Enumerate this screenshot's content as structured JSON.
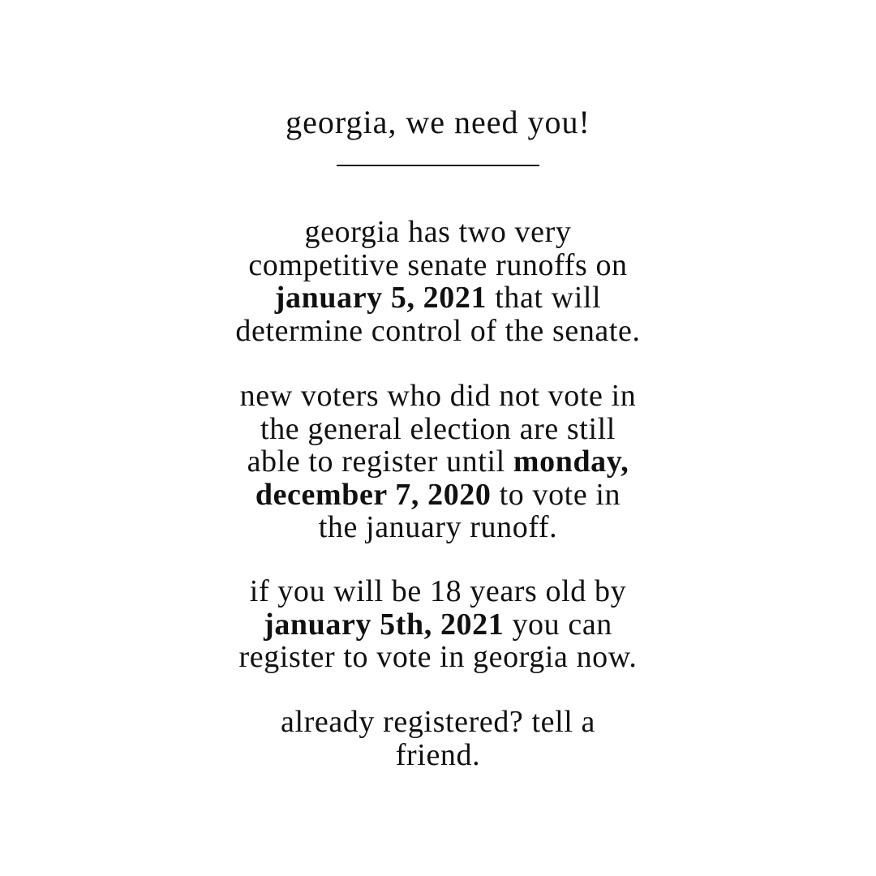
{
  "title": "georgia, we need you!",
  "paragraphs": {
    "p1": {
      "l1": "georgia has two very",
      "l2": "competitive senate runoffs on",
      "l3_bold": "january 5, 2021",
      "l3_rest": " that will",
      "l4": "determine control of the senate."
    },
    "p2": {
      "l1": "new voters who did not vote in",
      "l2": "the general election are still",
      "l3_text": "able to register until ",
      "l3_bold": "monday,",
      "l4_bold": "december 7, 2020",
      "l4_rest": " to vote in",
      "l5": "the january runoff."
    },
    "p3": {
      "l1": "if you will be 18 years old by",
      "l2_bold": "january 5th, 2021",
      "l2_rest": " you can",
      "l3": "register to vote in georgia now."
    },
    "p4": {
      "l1": "already registered? tell a",
      "l2": "friend."
    }
  }
}
